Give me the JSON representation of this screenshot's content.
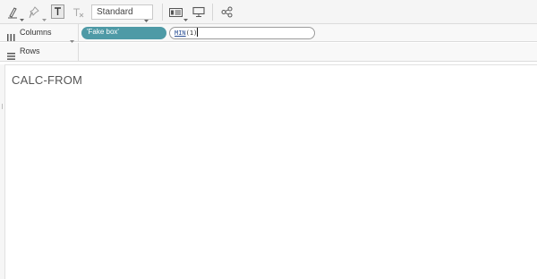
{
  "toolbar": {
    "icons": [
      "highlighter-icon",
      "pin-icon",
      "text-label-icon",
      "clear-format-icon",
      "show-cards-icon",
      "presentation-icon",
      "share-icon"
    ],
    "fit_select": {
      "value": "Standard"
    }
  },
  "shelves": {
    "columns": {
      "label": "Columns",
      "pills": [
        {
          "text": "'Fake box'",
          "color": "#4e9aa6"
        }
      ],
      "editor": {
        "function_name": "MIN",
        "argument": "(1)"
      }
    },
    "rows": {
      "label": "Rows"
    }
  },
  "canvas": {
    "text": "CALC-FROM"
  }
}
